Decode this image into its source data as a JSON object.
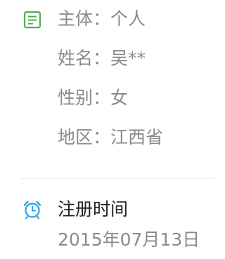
{
  "info": {
    "icon": "document-icon",
    "icon_color": "#4caf50",
    "rows": [
      {
        "label": "主体：",
        "value": "个人"
      },
      {
        "label": "姓名：",
        "value": "吴**"
      },
      {
        "label": "性别：",
        "value": "女"
      },
      {
        "label": "地区：",
        "value": "江西省"
      }
    ]
  },
  "registration": {
    "icon": "alarm-clock-icon",
    "icon_color": "#29a3e0",
    "title": "注册时间",
    "date": "2015年07月13日"
  }
}
